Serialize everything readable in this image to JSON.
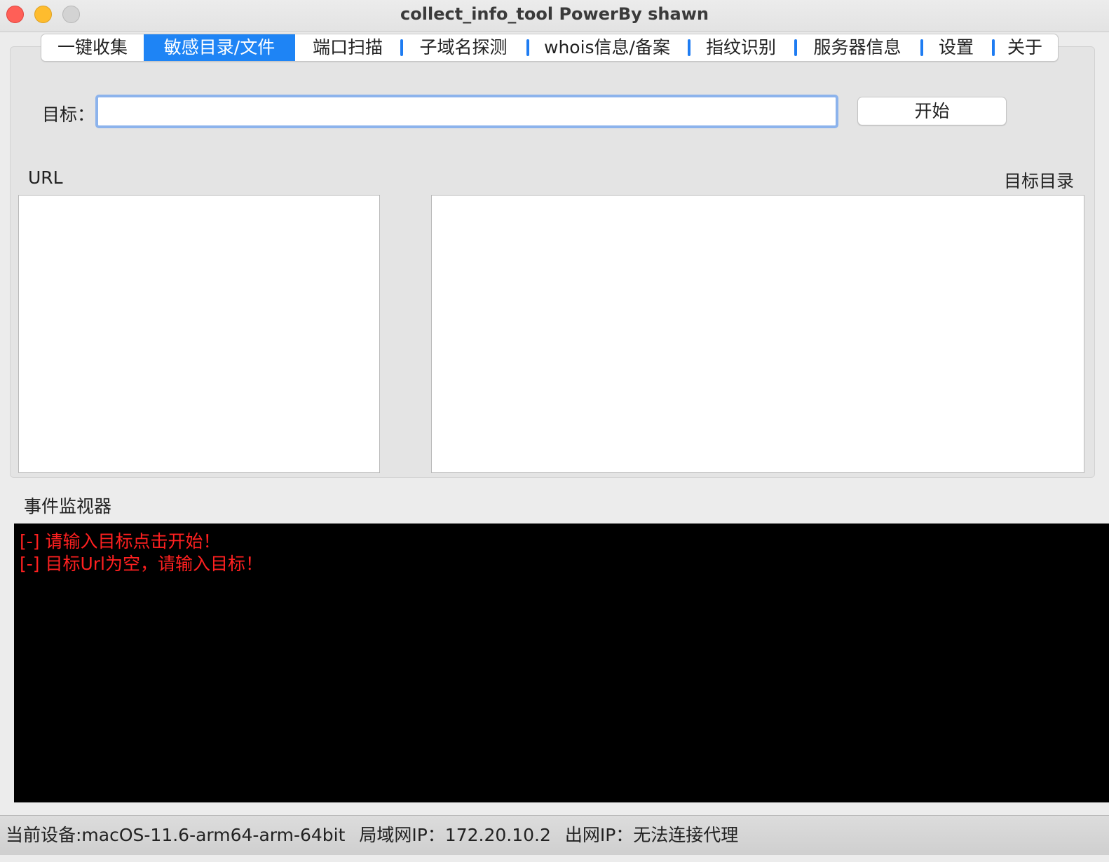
{
  "window": {
    "title": "collect_info_tool   PowerBy shawn"
  },
  "tabs": [
    {
      "label": "一键收集"
    },
    {
      "label": "敏感目录/文件"
    },
    {
      "label": "端口扫描"
    },
    {
      "label": "子域名探测"
    },
    {
      "label": "whois信息/备案"
    },
    {
      "label": "指纹识别"
    },
    {
      "label": "服务器信息"
    },
    {
      "label": "设置"
    },
    {
      "label": "关于"
    }
  ],
  "active_tab": "敏感目录/文件",
  "form": {
    "target_label": "目标：",
    "target_value": "",
    "start_label": "开始"
  },
  "panels": {
    "url_label": "URL",
    "dir_label": "目标目录"
  },
  "monitor": {
    "label": "事件监视器",
    "lines": [
      "[-] 请输入目标点击开始！",
      "[-] 目标Url为空，请输入目标！"
    ]
  },
  "status": {
    "device": "当前设备:macOS-11.6-arm64-arm-64bit",
    "lan_ip": "局域网IP：172.20.10.2",
    "wan_ip": "出网IP：无法连接代理"
  },
  "colors": {
    "accent": "#1e84f5",
    "console_bg": "#000000",
    "console_text": "#ff2020"
  }
}
